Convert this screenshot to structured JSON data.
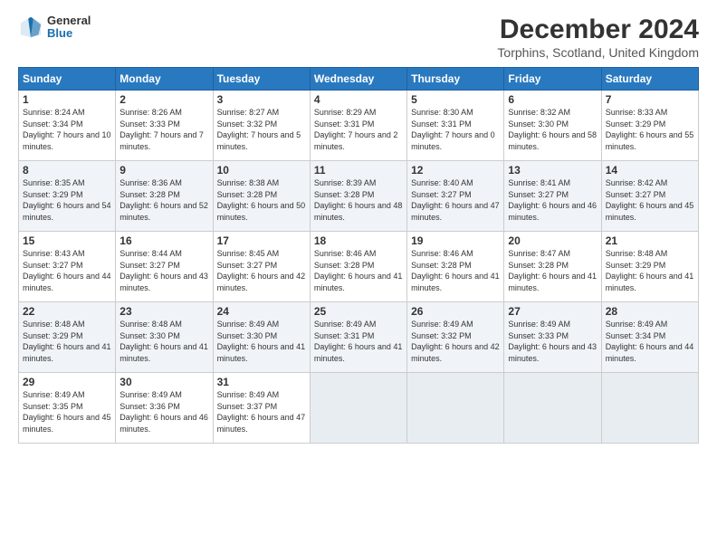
{
  "logo": {
    "general": "General",
    "blue": "Blue"
  },
  "title": "December 2024",
  "location": "Torphins, Scotland, United Kingdom",
  "days_of_week": [
    "Sunday",
    "Monday",
    "Tuesday",
    "Wednesday",
    "Thursday",
    "Friday",
    "Saturday"
  ],
  "weeks": [
    [
      {
        "day": "1",
        "sunrise": "8:24 AM",
        "sunset": "3:34 PM",
        "daylight": "7 hours and 10 minutes."
      },
      {
        "day": "2",
        "sunrise": "8:26 AM",
        "sunset": "3:33 PM",
        "daylight": "7 hours and 7 minutes."
      },
      {
        "day": "3",
        "sunrise": "8:27 AM",
        "sunset": "3:32 PM",
        "daylight": "7 hours and 5 minutes."
      },
      {
        "day": "4",
        "sunrise": "8:29 AM",
        "sunset": "3:31 PM",
        "daylight": "7 hours and 2 minutes."
      },
      {
        "day": "5",
        "sunrise": "8:30 AM",
        "sunset": "3:31 PM",
        "daylight": "7 hours and 0 minutes."
      },
      {
        "day": "6",
        "sunrise": "8:32 AM",
        "sunset": "3:30 PM",
        "daylight": "6 hours and 58 minutes."
      },
      {
        "day": "7",
        "sunrise": "8:33 AM",
        "sunset": "3:29 PM",
        "daylight": "6 hours and 55 minutes."
      }
    ],
    [
      {
        "day": "8",
        "sunrise": "8:35 AM",
        "sunset": "3:29 PM",
        "daylight": "6 hours and 54 minutes."
      },
      {
        "day": "9",
        "sunrise": "8:36 AM",
        "sunset": "3:28 PM",
        "daylight": "6 hours and 52 minutes."
      },
      {
        "day": "10",
        "sunrise": "8:38 AM",
        "sunset": "3:28 PM",
        "daylight": "6 hours and 50 minutes."
      },
      {
        "day": "11",
        "sunrise": "8:39 AM",
        "sunset": "3:28 PM",
        "daylight": "6 hours and 48 minutes."
      },
      {
        "day": "12",
        "sunrise": "8:40 AM",
        "sunset": "3:27 PM",
        "daylight": "6 hours and 47 minutes."
      },
      {
        "day": "13",
        "sunrise": "8:41 AM",
        "sunset": "3:27 PM",
        "daylight": "6 hours and 46 minutes."
      },
      {
        "day": "14",
        "sunrise": "8:42 AM",
        "sunset": "3:27 PM",
        "daylight": "6 hours and 45 minutes."
      }
    ],
    [
      {
        "day": "15",
        "sunrise": "8:43 AM",
        "sunset": "3:27 PM",
        "daylight": "6 hours and 44 minutes."
      },
      {
        "day": "16",
        "sunrise": "8:44 AM",
        "sunset": "3:27 PM",
        "daylight": "6 hours and 43 minutes."
      },
      {
        "day": "17",
        "sunrise": "8:45 AM",
        "sunset": "3:27 PM",
        "daylight": "6 hours and 42 minutes."
      },
      {
        "day": "18",
        "sunrise": "8:46 AM",
        "sunset": "3:28 PM",
        "daylight": "6 hours and 41 minutes."
      },
      {
        "day": "19",
        "sunrise": "8:46 AM",
        "sunset": "3:28 PM",
        "daylight": "6 hours and 41 minutes."
      },
      {
        "day": "20",
        "sunrise": "8:47 AM",
        "sunset": "3:28 PM",
        "daylight": "6 hours and 41 minutes."
      },
      {
        "day": "21",
        "sunrise": "8:48 AM",
        "sunset": "3:29 PM",
        "daylight": "6 hours and 41 minutes."
      }
    ],
    [
      {
        "day": "22",
        "sunrise": "8:48 AM",
        "sunset": "3:29 PM",
        "daylight": "6 hours and 41 minutes."
      },
      {
        "day": "23",
        "sunrise": "8:48 AM",
        "sunset": "3:30 PM",
        "daylight": "6 hours and 41 minutes."
      },
      {
        "day": "24",
        "sunrise": "8:49 AM",
        "sunset": "3:30 PM",
        "daylight": "6 hours and 41 minutes."
      },
      {
        "day": "25",
        "sunrise": "8:49 AM",
        "sunset": "3:31 PM",
        "daylight": "6 hours and 41 minutes."
      },
      {
        "day": "26",
        "sunrise": "8:49 AM",
        "sunset": "3:32 PM",
        "daylight": "6 hours and 42 minutes."
      },
      {
        "day": "27",
        "sunrise": "8:49 AM",
        "sunset": "3:33 PM",
        "daylight": "6 hours and 43 minutes."
      },
      {
        "day": "28",
        "sunrise": "8:49 AM",
        "sunset": "3:34 PM",
        "daylight": "6 hours and 44 minutes."
      }
    ],
    [
      {
        "day": "29",
        "sunrise": "8:49 AM",
        "sunset": "3:35 PM",
        "daylight": "6 hours and 45 minutes."
      },
      {
        "day": "30",
        "sunrise": "8:49 AM",
        "sunset": "3:36 PM",
        "daylight": "6 hours and 46 minutes."
      },
      {
        "day": "31",
        "sunrise": "8:49 AM",
        "sunset": "3:37 PM",
        "daylight": "6 hours and 47 minutes."
      },
      null,
      null,
      null,
      null
    ]
  ]
}
